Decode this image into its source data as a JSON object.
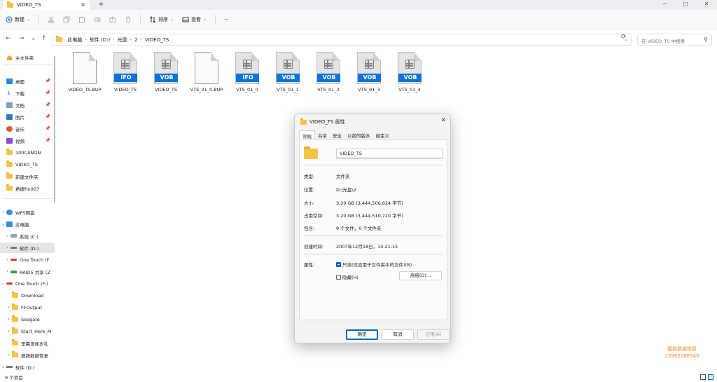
{
  "window": {
    "tab_title": "VIDEO_TS",
    "tab_close": "×",
    "tab_add": "+",
    "controls": [
      "−",
      "▢",
      "✕"
    ]
  },
  "toolbar": {
    "new_label": "新建",
    "sort_label": "排序",
    "view_label": "查看",
    "more_label": "···"
  },
  "nav": {
    "back": "←",
    "forward": "→",
    "recent": "⌄",
    "up": "↑",
    "breadcrumb": [
      "此电脑",
      "软件 (D:)",
      "光盘",
      "2",
      "VIDEO_TS"
    ],
    "refresh": "⟳",
    "search_placeholder": "在 VIDEO_TS 中搜索"
  },
  "sidebar": {
    "items": [
      {
        "label": "主文件夹",
        "icon": "home-icon",
        "pinned": false
      },
      {
        "label": "桌面",
        "icon": "desktop-icon",
        "pinned": true
      },
      {
        "label": "下载",
        "icon": "download-icon",
        "pinned": true
      },
      {
        "label": "文档",
        "icon": "documents-icon",
        "pinned": true
      },
      {
        "label": "图片",
        "icon": "pictures-icon",
        "pinned": true
      },
      {
        "label": "音乐",
        "icon": "music-icon",
        "pinned": true
      },
      {
        "label": "视频",
        "icon": "videos-icon",
        "pinned": true
      },
      {
        "label": "100CANON",
        "icon": "folder-icon",
        "pinned": false
      },
      {
        "label": "VIDEO_TS",
        "icon": "folder-icon",
        "pinned": false
      },
      {
        "label": "新建文件夹",
        "icon": "folder-icon",
        "pinned": false
      },
      {
        "label": "希捷fm007",
        "icon": "folder-icon",
        "pinned": false
      }
    ],
    "tree": [
      {
        "label": "WPS网盘",
        "icon": "cloud-icon",
        "expander": "›"
      },
      {
        "label": "此电脑",
        "icon": "pc-icon",
        "expander": "⌄"
      },
      {
        "label": "系统 (C:)",
        "icon": "drive-icon",
        "expander": "›"
      },
      {
        "label": "软件 (D:)",
        "icon": "drive-icon",
        "expander": "›"
      },
      {
        "label": "One Touch (F",
        "icon": "usb-drive-icon",
        "expander": "›"
      },
      {
        "label": "RAID5 共享 (Z",
        "icon": "network-drive-icon",
        "expander": "›"
      },
      {
        "label": "One Touch (F:)",
        "icon": "usb-drive-icon",
        "expander": "⌄"
      },
      {
        "label": "Download",
        "icon": "folder-icon",
        "expander": ""
      },
      {
        "label": "FFOutput",
        "icon": "folder-icon",
        "expander": "›"
      },
      {
        "label": "Seagate",
        "icon": "folder-icon",
        "expander": "›"
      },
      {
        "label": "Start_Here_M",
        "icon": "folder-icon",
        "expander": "›"
      },
      {
        "label": "李晨澄闻岁礼",
        "icon": "folder-icon",
        "expander": ""
      },
      {
        "label": "擅扬数据恢复",
        "icon": "folder-icon",
        "expander": "›"
      },
      {
        "label": "软件 (D:)",
        "icon": "drive-icon",
        "expander": "⌄"
      }
    ]
  },
  "files": [
    {
      "name": "VIDEO_TS.BUP",
      "type": "blank",
      "ext": ""
    },
    {
      "name": "VIDEO_TS",
      "type": "media",
      "ext": "IFO"
    },
    {
      "name": "VIDEO_TS",
      "type": "media",
      "ext": "VOB"
    },
    {
      "name": "VTS_01_0.BUP",
      "type": "blank",
      "ext": ""
    },
    {
      "name": "VTS_01_0",
      "type": "media",
      "ext": "IFO"
    },
    {
      "name": "VTS_01_1",
      "type": "media",
      "ext": "VOB"
    },
    {
      "name": "VTS_01_2",
      "type": "media",
      "ext": "VOB"
    },
    {
      "name": "VTS_01_3",
      "type": "media",
      "ext": "VOB"
    },
    {
      "name": "VTS_01_4",
      "type": "media",
      "ext": "VOB"
    }
  ],
  "dialog": {
    "title": "VIDEO_TS 属性",
    "close": "✕",
    "tabs": [
      "常规",
      "共享",
      "安全",
      "以前的版本",
      "自定义"
    ],
    "name_value": "VIDEO_TS",
    "type_label": "类型:",
    "type_value": "文件夹",
    "location_label": "位置:",
    "location_value": "D:\\光盘\\2",
    "size_label": "大小:",
    "size_value": "3.20 GB (3,444,506,624 字节)",
    "disk_label": "占用空间:",
    "disk_value": "3.20 GB (3,444,510,720 字节)",
    "contains_label": "包含:",
    "contains_value": "9 个文件，0 个文件夹",
    "created_label": "创建时间:",
    "created_value": "2007年12月18日，14:21:15",
    "attrs_label": "属性:",
    "readonly_label": "只读(仅应用于文件夹中的文件)(R)",
    "hidden_label": "隐藏(H)",
    "advanced_label": "高级(D)...",
    "ok_label": "确定",
    "cancel_label": "取消",
    "apply_label": "应用(A)"
  },
  "watermark": {
    "line1": "擅扬数据恢复",
    "line2": "13962186546",
    "color": "#f08c23"
  },
  "status": {
    "count": "9 个项目"
  },
  "colors": {
    "accent": "#0067c0",
    "ext_band": "#0a74da",
    "folder": "#f6c444"
  }
}
